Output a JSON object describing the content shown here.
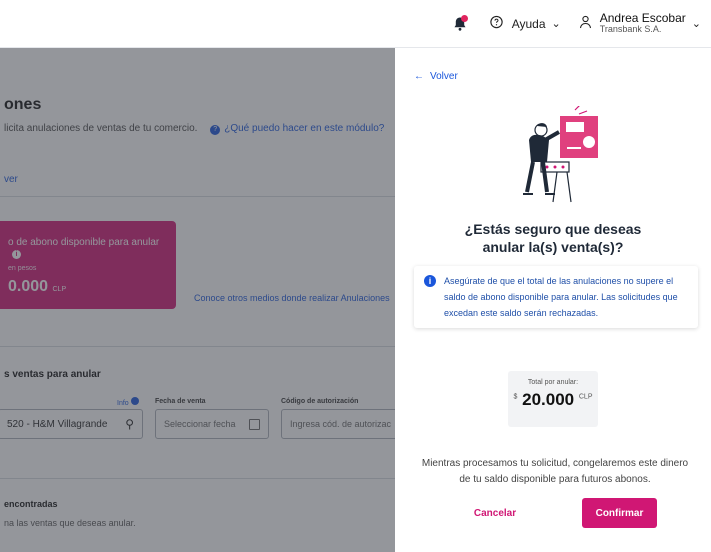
{
  "topbar": {
    "help_label": "Ayuda",
    "user_name": "Andrea Escobar",
    "user_org": "Transbank S.A."
  },
  "background": {
    "title": "ones",
    "subtitle": "licita anulaciones de ventas de tu comercio.",
    "help_link": "¿Qué puedo hacer en este módulo?",
    "back_link": "ver",
    "balance_card": {
      "title": "o de abono disponible para anular",
      "subtitle": "en pesos",
      "value": "0.000",
      "currency": "CLP"
    },
    "other_methods_link": "Conoce otros medios donde realizar Anulaciones",
    "section_title": "s ventas para anular",
    "info_label": "Info",
    "date_label": "Fecha de venta",
    "auth_label": "Código de autorización",
    "store_value": "520 - H&M Villagrande",
    "date_placeholder": "Seleccionar fecha",
    "auth_placeholder": "Ingresa cód. de autorizac",
    "found_title": "encontradas",
    "found_subtitle": "na las ventas que deseas anular."
  },
  "panel": {
    "back_label": "Volver",
    "heading_line1": "¿Estás seguro que deseas",
    "heading_line2": "anular la(s) venta(s)?",
    "alert_text": "Asegúrate de que el total de las anulaciones no supere el saldo de abono disponible para anular. Las solicitudes que excedan este saldo serán rechazadas.",
    "total_label": "Total por anular:",
    "total_symbol": "$",
    "total_value": "20.000",
    "total_currency": "CLP",
    "note": "Mientras procesamos tu solicitud, congelaremos este dinero de tu saldo disponible para futuros abonos.",
    "cancel_label": "Cancelar",
    "confirm_label": "Confirmar"
  },
  "colors": {
    "brand": "#d01774",
    "link": "#1a56db"
  }
}
